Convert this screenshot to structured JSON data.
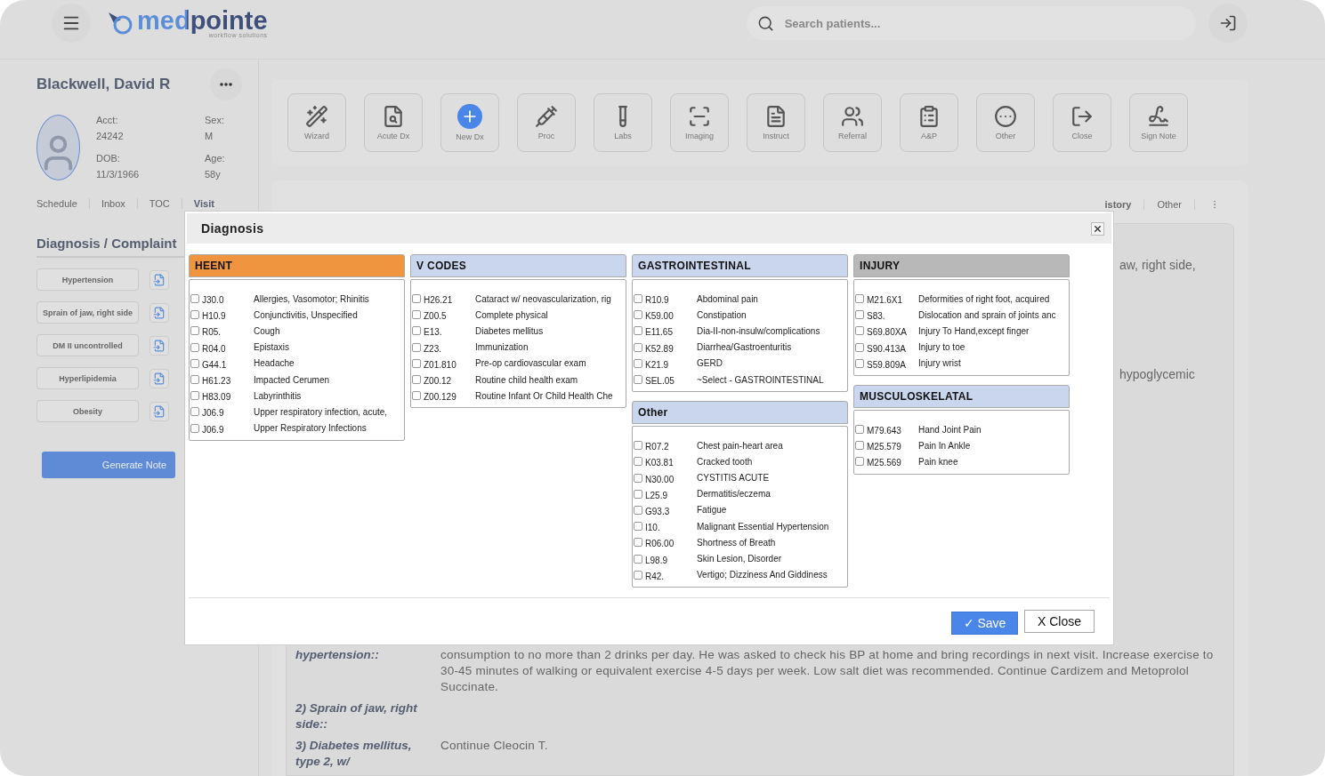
{
  "header": {
    "logo": "medpointe",
    "tagline": "workflow solutions",
    "search": {
      "placeholder": "Search patients..."
    }
  },
  "patient": {
    "name": "Blackwell, David R",
    "fields": [
      {
        "label": "Acct:",
        "value": "24242"
      },
      {
        "label": "Sex:",
        "value": "M"
      },
      {
        "label": "DOB:",
        "value": "11/3/1966"
      },
      {
        "label": "Age:",
        "value": "58y"
      }
    ]
  },
  "nav_tabs": [
    {
      "label": "Schedule",
      "selected": false
    },
    {
      "label": "Inbox",
      "selected": false
    },
    {
      "label": "TOC",
      "selected": false
    },
    {
      "label": "Visit",
      "selected": true
    }
  ],
  "complaints": {
    "title": "Diagnosis / Complaint",
    "items": [
      "Hypertension",
      "Sprain of jaw, right side",
      "DM II uncontrolled",
      "Hyperlipidemia",
      "Obesity"
    ],
    "generate_button": "Generate Note"
  },
  "toolbar": [
    {
      "label": "Wizard"
    },
    {
      "label": "Acute Dx"
    },
    {
      "label": "New Dx"
    },
    {
      "label": "Proc"
    },
    {
      "label": "Labs"
    },
    {
      "label": "Imaging"
    },
    {
      "label": "Instruct"
    },
    {
      "label": "Referral"
    },
    {
      "label": "A&P"
    },
    {
      "label": "Other"
    },
    {
      "label": "Close"
    },
    {
      "label": "Sign Note"
    }
  ],
  "content_tabs": [
    {
      "label": "istory",
      "selected": true
    },
    {
      "label": "Other",
      "selected": false
    }
  ],
  "note": {
    "fragments": [
      "aw, right side,",
      "hypoglycemic"
    ],
    "rows": [
      {
        "label": "hypertension::",
        "text": "consumption to no more than 2 drinks per day. He was asked to check his BP at home and bring recordings in next visit. Increase exercise to 30-45 minutes of walking or equivalent exercise 4-5 days per week. Low salt diet was recommended. Continue Cardizem and Metoprolol Succinate."
      },
      {
        "label": "2) Sprain of jaw, right side::",
        "text": ""
      },
      {
        "label": "3) Diabetes mellitus, type 2, w/",
        "text": "Continue Cleocin T."
      }
    ]
  },
  "dialog": {
    "title": "Diagnosis",
    "save": "✓ Save",
    "close": "X Close",
    "columns": [
      [
        {
          "title": "HEENT",
          "color": "#f0953f",
          "items": [
            {
              "code": "J30.0",
              "label": "Allergies, Vasomotor; Rhinitis",
              "checked": false
            },
            {
              "code": "H10.9",
              "label": "Conjunctivitis, Unspecified",
              "checked": false
            },
            {
              "code": "R05.",
              "label": "Cough",
              "checked": false
            },
            {
              "code": "R04.0",
              "label": "Epistaxis",
              "checked": false
            },
            {
              "code": "G44.1",
              "label": "Headache",
              "checked": false
            },
            {
              "code": "H61.23",
              "label": "Impacted Cerumen",
              "checked": false
            },
            {
              "code": "H83.09",
              "label": "Labyrinthitis",
              "checked": false
            },
            {
              "code": "J06.9",
              "label": "Upper respiratory infection, acute,",
              "checked": false
            },
            {
              "code": "J06.9",
              "label": "Upper Respiratory Infections",
              "checked": false
            }
          ]
        }
      ],
      [
        {
          "title": "V CODES",
          "color": "#c9d6ee",
          "items": [
            {
              "code": "H26.21",
              "label": "Cataract w/ neovascularization, rig",
              "checked": false
            },
            {
              "code": "Z00.5",
              "label": "Complete physical",
              "checked": false
            },
            {
              "code": "E13.",
              "label": "Diabetes mellitus",
              "checked": false
            },
            {
              "code": "Z23.",
              "label": "Immunization",
              "checked": false
            },
            {
              "code": "Z01.810",
              "label": "Pre-op cardiovascular exam",
              "checked": false
            },
            {
              "code": "Z00.12",
              "label": "Routine child health exam",
              "checked": false
            },
            {
              "code": "Z00.129",
              "label": "Routine Infant Or Child Health Che",
              "checked": false
            }
          ]
        }
      ],
      [
        {
          "title": "GASTROINTESTINAL",
          "color": "#c9d6ee",
          "items": [
            {
              "code": "R10.9",
              "label": "Abdominal pain",
              "checked": false
            },
            {
              "code": "K59.00",
              "label": "Constipation",
              "checked": false
            },
            {
              "code": "E11.65",
              "label": "Dia-II-non-insulw/complications",
              "checked": false
            },
            {
              "code": "K52.89",
              "label": "Diarrhea/Gastroenturitis",
              "checked": false
            },
            {
              "code": "K21.9",
              "label": "GERD",
              "checked": false
            },
            {
              "code": "SEL.05",
              "label": "~Select - GASTROINTESTINAL",
              "checked": false
            }
          ]
        },
        {
          "title": "Other",
          "color": "#c9d6ee",
          "items": [
            {
              "code": "R07.2",
              "label": "Chest pain-heart area",
              "checked": false
            },
            {
              "code": "K03.81",
              "label": "Cracked tooth",
              "checked": false
            },
            {
              "code": "N30.00",
              "label": "CYSTITIS ACUTE",
              "checked": false
            },
            {
              "code": "L25.9",
              "label": "Dermatitis/eczema",
              "checked": false
            },
            {
              "code": "G93.3",
              "label": "Fatigue",
              "checked": false
            },
            {
              "code": "I10.",
              "label": "Malignant Essential Hypertension",
              "checked": false
            },
            {
              "code": "R06.00",
              "label": "Shortness of Breath",
              "checked": false
            },
            {
              "code": "L98.9",
              "label": "Skin Lesion, Disorder",
              "checked": false
            },
            {
              "code": "R42.",
              "label": "Vertigo; Dizziness And Giddiness",
              "checked": false
            }
          ]
        }
      ],
      [
        {
          "title": "INJURY",
          "color": "#b8b8b8",
          "items": [
            {
              "code": "M21.6X1",
              "label": "Deformities of right foot, acquired",
              "checked": false
            },
            {
              "code": "S83.",
              "label": "Dislocation and sprain of joints anc",
              "checked": false
            },
            {
              "code": "S69.80XA",
              "label": "Injury To Hand,except finger",
              "checked": false
            },
            {
              "code": "S90.413A",
              "label": "Injury to toe",
              "checked": false
            },
            {
              "code": "S59.809A",
              "label": "Injury wrist",
              "checked": false
            }
          ]
        },
        {
          "title": "MUSCULOSKELATAL",
          "color": "#c9d6ee",
          "items": [
            {
              "code": "M79.643",
              "label": "Hand Joint Pain",
              "checked": false
            },
            {
              "code": "M25.579",
              "label": "Pain In Ankle",
              "checked": false
            },
            {
              "code": "M25.569",
              "label": "Pain knee",
              "checked": false
            }
          ]
        }
      ]
    ]
  }
}
